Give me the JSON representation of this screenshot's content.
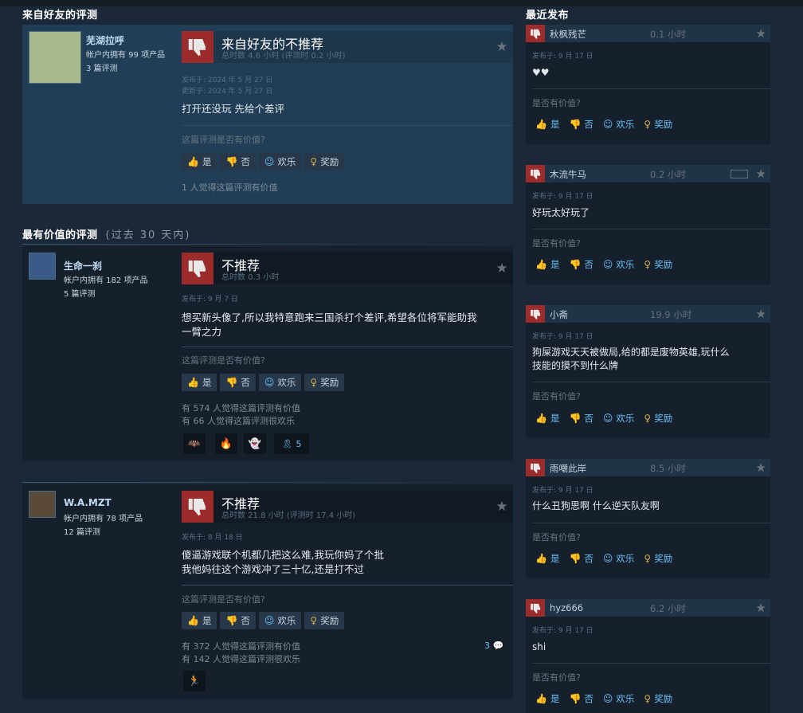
{
  "sections": {
    "friends_title": "来自好友的评测",
    "helpful_title": "最有价值的评测",
    "helpful_range": "(过去 30 天内)",
    "recent_title": "最近发布"
  },
  "labels": {
    "ask": "这篇评测是否有价值?",
    "yes": "是",
    "no": "否",
    "funny": "欢乐",
    "award": "奖励",
    "side_ask": "是否有价值?",
    "posted_prefix": "发布于:"
  },
  "friend_review": {
    "author": "芜湖拉呼",
    "products": "帐户内拥有 99 项产品",
    "reviews": "3 篇评测",
    "verdict": "来自好友的不推荐",
    "hours": "总时数 4.6 小时 (评测时 0.2 小时)",
    "posted": "发布于: 2024 年 5 月 27 日",
    "updated": "更新于: 2024 年 5 月 27 日",
    "text": "打开还没玩 先给个差评",
    "helpful": "1 人觉得这篇评测有价值"
  },
  "helpful_reviews": [
    {
      "author": "生命一刹",
      "products": "帐户内拥有 182 项产品",
      "reviews": "5 篇评测",
      "verdict": "不推荐",
      "hours": "总时数 0.3 小时",
      "posted": "发布于: 9 月 7 日",
      "text1": "想买新头像了,所以我特意跑来三国杀打个差评,希望各位将军能助我",
      "text2": "一臂之力",
      "helpful": "有 574 人觉得这篇评测有价值",
      "funny": "有 66 人觉得这篇评测很欢乐",
      "award_count": "5"
    },
    {
      "author": "W.A.MZT",
      "products": "帐户内拥有 78 项产品",
      "reviews": "12 篇评测",
      "verdict": "不推荐",
      "hours": "总时数 21.8 小时 (评测时 17.4 小时)",
      "posted": "发布于: 8 月 18 日",
      "text1": "傻逼游戏联个机都几把这么难,我玩你妈了个批",
      "text2": "我他妈往这个游戏冲了三十亿,还是打不过",
      "helpful": "有 372 人觉得这篇评测有价值",
      "funny": "有 142 人觉得这篇评测很欢乐",
      "comments": "3"
    }
  ],
  "recent_reviews": [
    {
      "author": "秋枫残芒",
      "hours": "0.1 小时",
      "posted": "发布于: 9 月 17 日",
      "text1": "♥♥",
      "text2": ""
    },
    {
      "author": "木流牛马",
      "hours": "0.2 小时",
      "posted": "发布于: 9 月 17 日",
      "text1": "好玩太好玩了",
      "text2": ""
    },
    {
      "author": "小斋",
      "hours": "19.9 小时",
      "posted": "发布于: 9 月 17 日",
      "text1": "狗屎游戏天天被做局,给的都是废物英雄,玩什么",
      "text2": "技能的摸不到什么牌"
    },
    {
      "author": "雨嘲此岸",
      "hours": "8.5 小时",
      "posted": "发布于: 9 月 17 日",
      "text1": "什么丑狗思啊 什么逆天队友啊",
      "text2": ""
    },
    {
      "author": "hyz666",
      "hours": "6.2 小时",
      "posted": "发布于: 9 月 17 日",
      "text1": "shi",
      "text2": ""
    }
  ],
  "colors": {
    "thumb_down": "#9c2b2b",
    "link": "#67c1f5",
    "award": "#d4b04e"
  }
}
